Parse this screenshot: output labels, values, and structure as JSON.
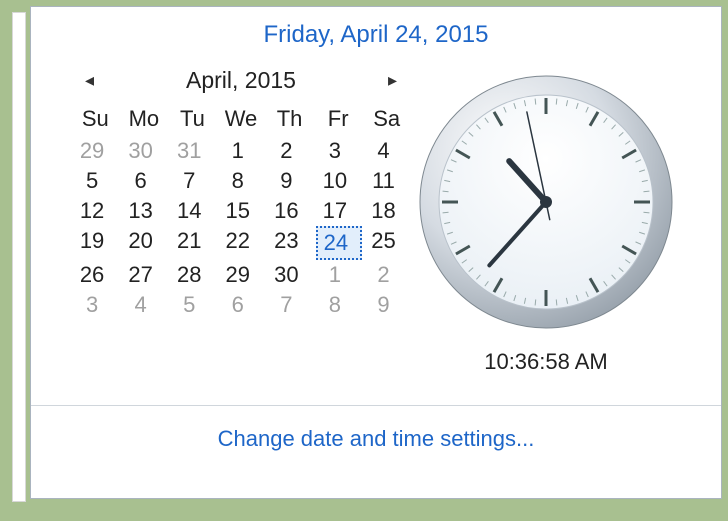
{
  "header": {
    "full_date": "Friday, April 24, 2015"
  },
  "calendar": {
    "month_label": "April, 2015",
    "day_headers": [
      "Su",
      "Mo",
      "Tu",
      "We",
      "Th",
      "Fr",
      "Sa"
    ],
    "rows": [
      [
        {
          "n": 29,
          "other": true
        },
        {
          "n": 30,
          "other": true
        },
        {
          "n": 31,
          "other": true
        },
        {
          "n": 1
        },
        {
          "n": 2
        },
        {
          "n": 3
        },
        {
          "n": 4
        }
      ],
      [
        {
          "n": 5
        },
        {
          "n": 6
        },
        {
          "n": 7
        },
        {
          "n": 8
        },
        {
          "n": 9
        },
        {
          "n": 10
        },
        {
          "n": 11
        }
      ],
      [
        {
          "n": 12
        },
        {
          "n": 13
        },
        {
          "n": 14
        },
        {
          "n": 15
        },
        {
          "n": 16
        },
        {
          "n": 17
        },
        {
          "n": 18
        }
      ],
      [
        {
          "n": 19
        },
        {
          "n": 20
        },
        {
          "n": 21
        },
        {
          "n": 22
        },
        {
          "n": 23
        },
        {
          "n": 24,
          "selected": true
        },
        {
          "n": 25
        }
      ],
      [
        {
          "n": 26
        },
        {
          "n": 27
        },
        {
          "n": 28
        },
        {
          "n": 29
        },
        {
          "n": 30
        },
        {
          "n": 1,
          "other": true
        },
        {
          "n": 2,
          "other": true
        }
      ],
      [
        {
          "n": 3,
          "other": true
        },
        {
          "n": 4,
          "other": true
        },
        {
          "n": 5,
          "other": true
        },
        {
          "n": 6,
          "other": true
        },
        {
          "n": 7,
          "other": true
        },
        {
          "n": 8,
          "other": true
        },
        {
          "n": 9,
          "other": true
        }
      ]
    ]
  },
  "clock": {
    "digital": "10:36:58 AM",
    "hour": 10,
    "minute": 36,
    "second": 58
  },
  "footer": {
    "link": "Change date and time settings..."
  },
  "nav": {
    "prev": "◂",
    "next": "▸"
  }
}
